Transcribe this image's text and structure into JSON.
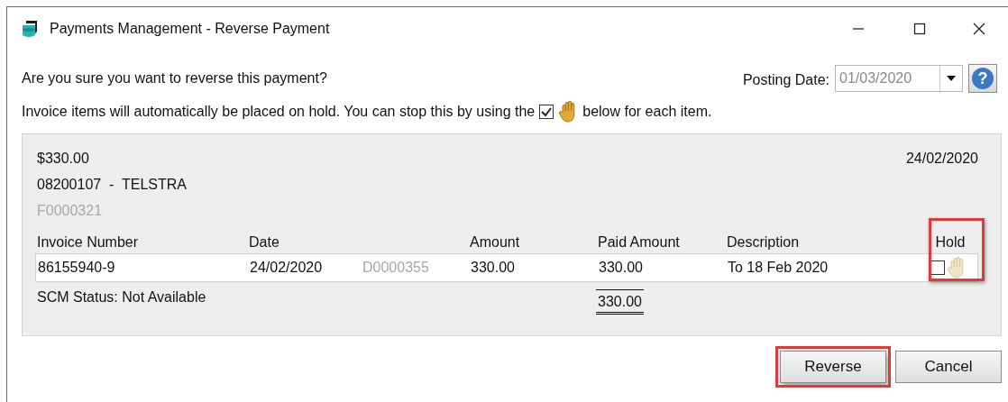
{
  "window": {
    "title": "Payments Management - Reverse Payment"
  },
  "prompt": "Are you sure you want to reverse this payment?",
  "posting_date": {
    "label": "Posting Date:",
    "value": "01/03/2020",
    "help": "?"
  },
  "notice": {
    "before": "Invoice items will automatically be placed on hold. You can stop this by using the",
    "after": "below for each item.",
    "checked": true
  },
  "payment": {
    "amount": "$330.00",
    "date": "24/02/2020",
    "vendor": "08200107  -  TELSTRA",
    "reference": "F0000321"
  },
  "table": {
    "columns": [
      "Invoice Number",
      "Date",
      "",
      "Amount",
      "Paid Amount",
      "Description",
      "Hold"
    ],
    "hold_highlighted": true,
    "rows": [
      {
        "cells": [
          {
            "kind": "text",
            "text": "86155940-9"
          },
          {
            "kind": "text",
            "text": "24/02/2020"
          },
          {
            "kind": "muted",
            "text": "D0000355"
          },
          {
            "kind": "text",
            "text": "330.00"
          },
          {
            "kind": "text",
            "text": "330.00"
          },
          {
            "kind": "text",
            "text": "To 18 Feb 2020"
          },
          {
            "kind": "hold",
            "checked": false
          }
        ]
      }
    ],
    "scm_status": "SCM Status: Not Available",
    "total": "330.00"
  },
  "buttons": [
    {
      "label": "Reverse",
      "highlighted": true
    },
    {
      "label": "Cancel",
      "highlighted": false
    }
  ]
}
